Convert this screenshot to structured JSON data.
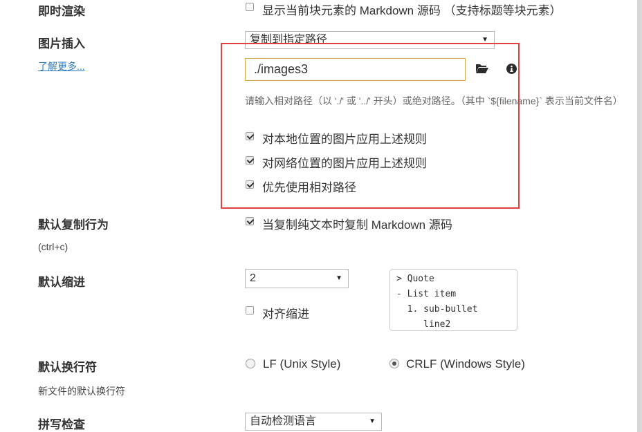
{
  "colors": {
    "accent_red": "#e0403e",
    "link": "#2f7bbf",
    "input_border": "#d5a84a"
  },
  "instant_render": {
    "label": "即时渲染",
    "option_label": "显示当前块元素的 Markdown 源码 （支持标题等块元素）",
    "checked": false
  },
  "image_insert": {
    "label": "图片插入",
    "learn_more": "了解更多...",
    "dropdown_value": "复制到指定路径",
    "path_value": "./images3",
    "folder_icon": "folder-open-icon",
    "info_icon": "info-icon",
    "hint": "请输入相对路径（以 './' 或 '../' 开头）或绝对路径。（其中 `${filename}` 表示当前文件名）",
    "options": [
      {
        "label": "对本地位置的图片应用上述规则",
        "checked": true
      },
      {
        "label": "对网络位置的图片应用上述规则",
        "checked": true
      },
      {
        "label": "优先使用相对路径",
        "checked": true
      }
    ]
  },
  "copy_behavior": {
    "label": "默认复制行为",
    "sublabel": "(ctrl+c)",
    "option_label": "当复制纯文本时复制 Markdown 源码",
    "checked": true
  },
  "indent": {
    "label": "默认缩进",
    "dropdown_value": "2",
    "align_label": "对齐缩进",
    "align_checked": false,
    "preview_lines": [
      "> Quote",
      "- List item",
      "  1. sub-bullet",
      "     line2"
    ]
  },
  "line_ending": {
    "label": "默认换行符",
    "sublabel": "新文件的默认换行符",
    "options": [
      {
        "label": "LF (Unix Style)",
        "selected": false
      },
      {
        "label": "CRLF (Windows Style)",
        "selected": true
      }
    ]
  },
  "spellcheck": {
    "label": "拼写检查",
    "dropdown_value": "自动检测语言"
  }
}
